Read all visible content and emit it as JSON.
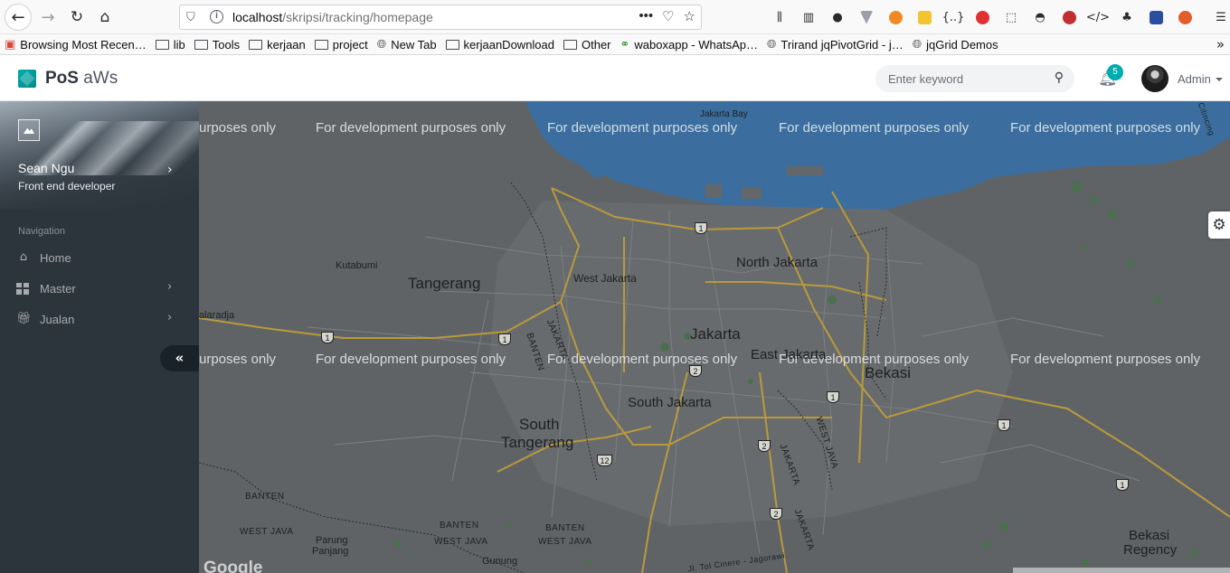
{
  "browser": {
    "url_host": "localhost",
    "url_path": "/skripsi/tracking/homepage",
    "bookmarks": [
      {
        "label": "Browsing Most Recen…",
        "icon": "bookmark-icon"
      },
      {
        "label": "lib",
        "icon": "folder-icon"
      },
      {
        "label": "Tools",
        "icon": "folder-icon"
      },
      {
        "label": "kerjaan",
        "icon": "folder-icon"
      },
      {
        "label": "project",
        "icon": "folder-icon"
      },
      {
        "label": "New Tab",
        "icon": "globe-icon"
      },
      {
        "label": "kerjaanDownload",
        "icon": "folder-icon"
      },
      {
        "label": "Other",
        "icon": "folder-icon"
      },
      {
        "label": "waboxapp - WhatsAp…",
        "icon": "link-icon"
      },
      {
        "label": "Trirand jqPivotGrid - j…",
        "icon": "globe-icon"
      },
      {
        "label": "jqGrid Demos",
        "icon": "globe-icon"
      }
    ]
  },
  "header": {
    "brand_bold": "PoS",
    "brand_light": "aWs",
    "search_placeholder": "Enter keyword",
    "notification_count": "5",
    "user_name": "Admin"
  },
  "sidebar": {
    "profile_name": "Sean Ngu",
    "profile_role": "Front end developer",
    "nav_header": "Navigation",
    "items": [
      {
        "label": "Home",
        "icon": "home-icon",
        "has_children": false
      },
      {
        "label": "Master",
        "icon": "grid-icon",
        "has_children": true
      },
      {
        "label": "Jualan",
        "icon": "gift-icon",
        "has_children": true
      }
    ],
    "minify_glyph": "«"
  },
  "map": {
    "watermark": "For development purposes only",
    "watermark_cut": "urposes only",
    "labels": {
      "tangerang": "Tangerang",
      "west_jakarta": "West Jakarta",
      "north_jakarta": "North Jakarta",
      "jakarta": "Jakarta",
      "east_jakarta": "East Jakarta",
      "bekasi": "Bekasi",
      "south_jakarta": "South Jakarta",
      "south_tangerang": "South Tangerang",
      "kutabumi": "Kutabumi",
      "balaraja": "alaradja",
      "jakarta_bay": "Jakarta Bay",
      "bekasi_regency": "Bekasi Regency",
      "parung_panjang": "Parung Panjang",
      "gunung_sindur": "Gunung Sindur",
      "banten1": "BANTEN",
      "banten2": "BANTEN",
      "banten3": "BANTEN",
      "west_java1": "WEST JAVA",
      "west_java2": "WEST JAVA",
      "west_java3": "WEST JAVA",
      "jakarta_vert": "JAKARTA",
      "banten_vert": "BANTEN",
      "jakarta_vert2": "JAKARTA",
      "west_java_vert": "WEST JAVA",
      "jakarta_vert3": "JAKARTA",
      "toll": "Jl. Tol Cinere - Jagorawi",
      "cilincing": "Cilincing"
    },
    "shields": [
      "1",
      "1",
      "1",
      "2",
      "1",
      "1",
      "1",
      "2",
      "2",
      "12"
    ],
    "google": "Google"
  },
  "colors": {
    "accent": "#00acac",
    "sidebar_bg": "#2d353c",
    "map_overlay": "#5d6163",
    "water": "#3a6fa6"
  }
}
